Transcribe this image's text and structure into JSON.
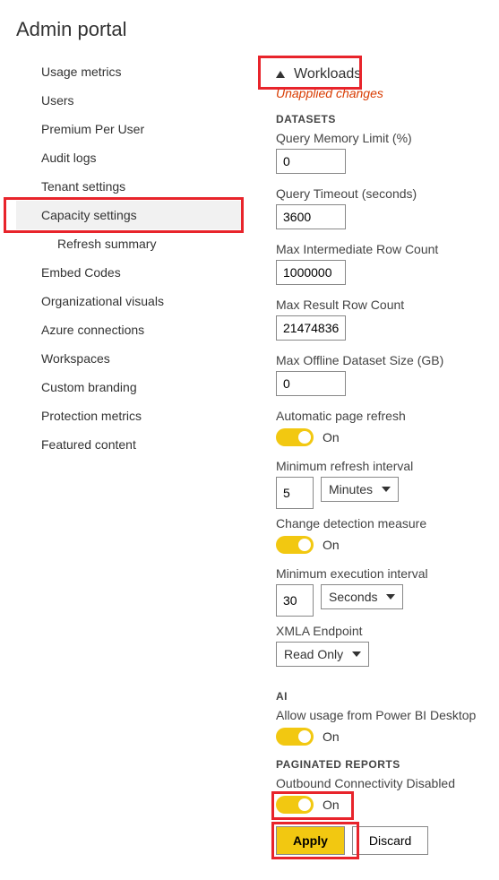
{
  "page_title": "Admin portal",
  "sidebar": {
    "items": [
      {
        "label": "Usage metrics",
        "selected": false
      },
      {
        "label": "Users",
        "selected": false
      },
      {
        "label": "Premium Per User",
        "selected": false
      },
      {
        "label": "Audit logs",
        "selected": false
      },
      {
        "label": "Tenant settings",
        "selected": false
      },
      {
        "label": "Capacity settings",
        "selected": true
      },
      {
        "label": "Refresh summary",
        "selected": false,
        "child": true
      },
      {
        "label": "Embed Codes",
        "selected": false
      },
      {
        "label": "Organizational visuals",
        "selected": false
      },
      {
        "label": "Azure connections",
        "selected": false
      },
      {
        "label": "Workspaces",
        "selected": false
      },
      {
        "label": "Custom branding",
        "selected": false
      },
      {
        "label": "Protection metrics",
        "selected": false
      },
      {
        "label": "Featured content",
        "selected": false
      }
    ]
  },
  "main": {
    "section_title": "Workloads",
    "unapplied_text": "Unapplied changes",
    "datasets": {
      "header": "DATASETS",
      "query_memory_limit_label": "Query Memory Limit (%)",
      "query_memory_limit_value": "0",
      "query_timeout_label": "Query Timeout (seconds)",
      "query_timeout_value": "3600",
      "max_intermediate_label": "Max Intermediate Row Count",
      "max_intermediate_value": "1000000",
      "max_result_label": "Max Result Row Count",
      "max_result_value": "21474836",
      "max_offline_label": "Max Offline Dataset Size (GB)",
      "max_offline_value": "0",
      "auto_refresh_label": "Automatic page refresh",
      "auto_refresh_state": "On",
      "min_refresh_label": "Minimum refresh interval",
      "min_refresh_value": "5",
      "min_refresh_unit": "Minutes",
      "change_detection_label": "Change detection measure",
      "change_detection_state": "On",
      "min_exec_label": "Minimum execution interval",
      "min_exec_value": "30",
      "min_exec_unit": "Seconds",
      "xmla_label": "XMLA Endpoint",
      "xmla_value": "Read Only"
    },
    "ai": {
      "header": "AI",
      "allow_desktop_label": "Allow usage from Power BI Desktop",
      "allow_desktop_state": "On"
    },
    "paginated": {
      "header": "PAGINATED REPORTS",
      "outbound_label": "Outbound Connectivity Disabled",
      "outbound_state": "On"
    },
    "apply_label": "Apply",
    "discard_label": "Discard"
  }
}
